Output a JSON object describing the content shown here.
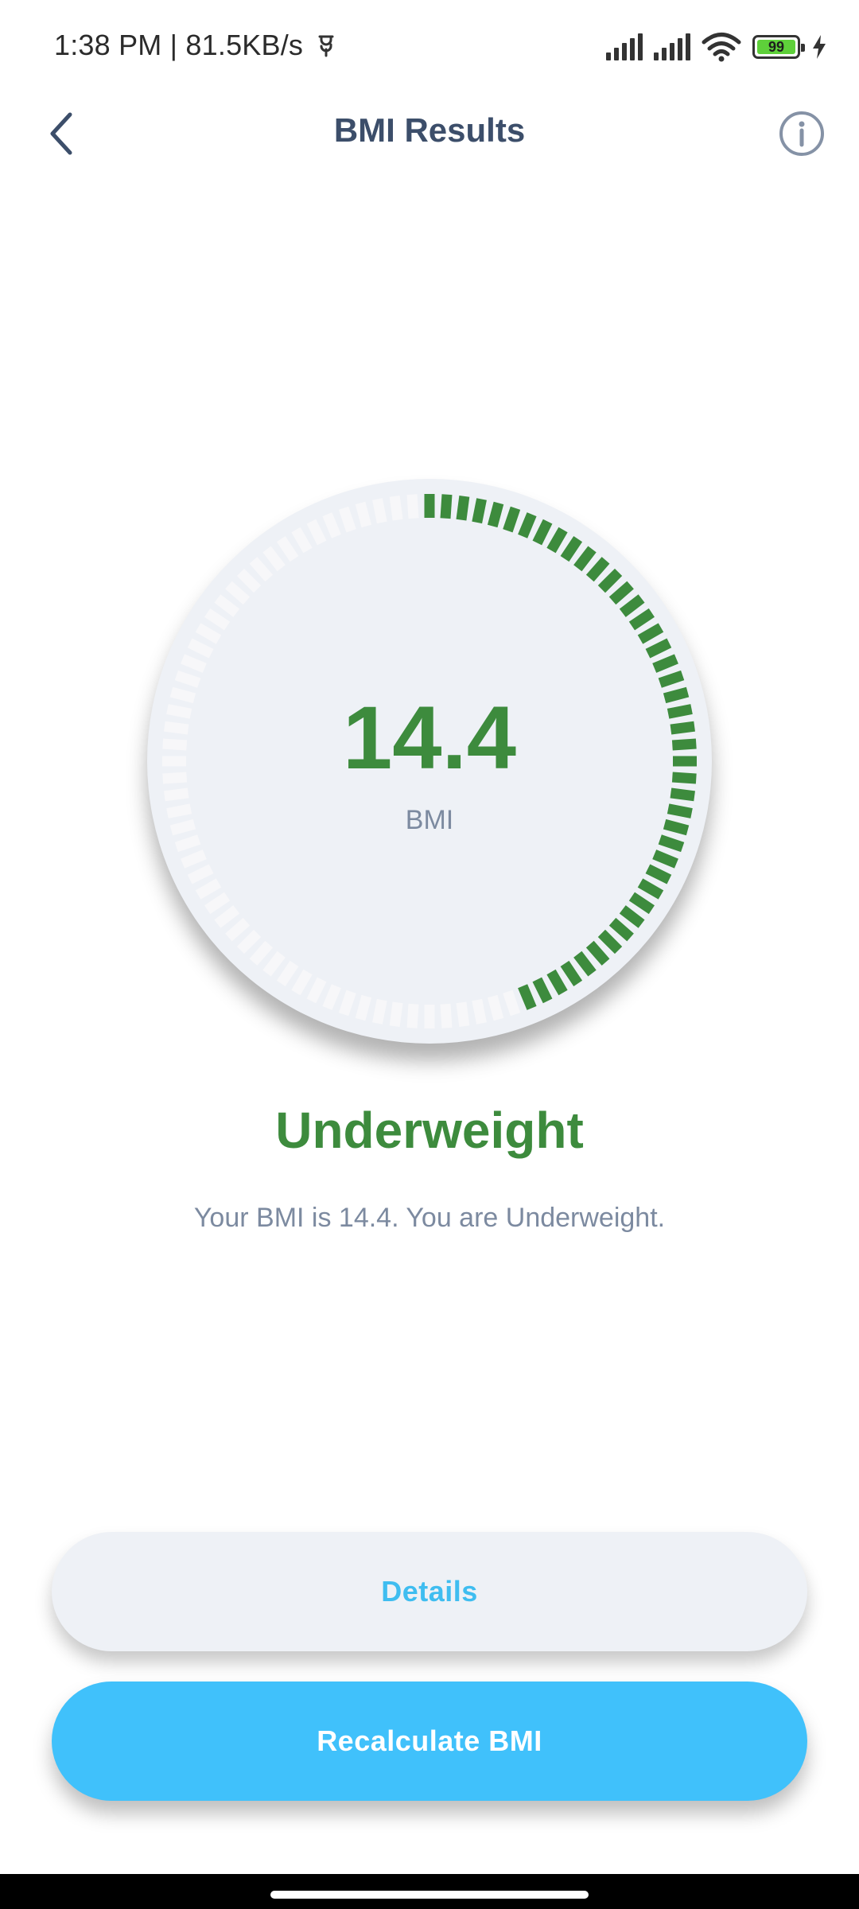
{
  "status_bar": {
    "time": "1:38 PM | 81.5KB/s",
    "battery_level": "99",
    "battery_color": "#5ed03a"
  },
  "header": {
    "title": "BMI Results",
    "back_icon": "chevron-left-icon",
    "info_icon": "info-icon"
  },
  "gauge": {
    "value": "14.4",
    "unit": "BMI",
    "fill_fraction": 0.45,
    "active_color": "#3d8b3d",
    "inactive_color": "#f7f7f9"
  },
  "result": {
    "category": "Underweight",
    "message": "Your BMI is 14.4. You are Underweight."
  },
  "buttons": {
    "details": "Details",
    "recalculate": "Recalculate BMI"
  },
  "colors": {
    "accent": "#40c1fb",
    "title": "#3c4e6a",
    "status": "#3d8b3d"
  }
}
